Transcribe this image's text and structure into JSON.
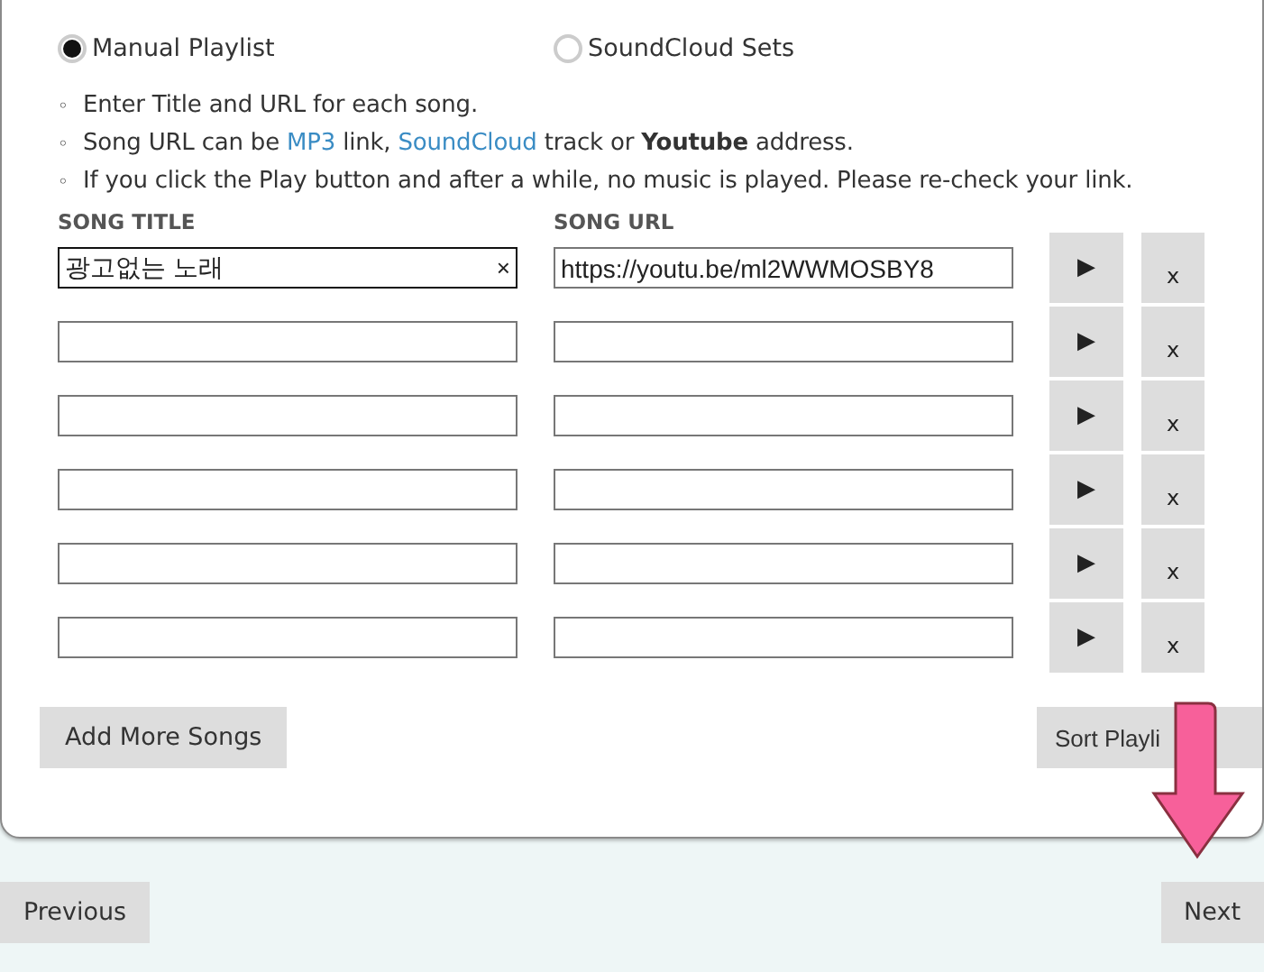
{
  "source_options": [
    {
      "label": "Manual Playlist",
      "selected": true
    },
    {
      "label": "SoundCloud Sets",
      "selected": false
    }
  ],
  "notes": [
    {
      "bullet": "◦",
      "segments": [
        {
          "kind": "plain",
          "text": "Enter Title and URL for each song."
        }
      ]
    },
    {
      "bullet": "◦",
      "segments": [
        {
          "kind": "plain",
          "text": "Song URL can be "
        },
        {
          "kind": "link",
          "text": "MP3"
        },
        {
          "kind": "plain",
          "text": " link, "
        },
        {
          "kind": "link",
          "text": "SoundCloud"
        },
        {
          "kind": "plain",
          "text": " track or "
        },
        {
          "kind": "bold",
          "text": "Youtube"
        },
        {
          "kind": "plain",
          "text": " address."
        }
      ]
    },
    {
      "bullet": "◦",
      "segments": [
        {
          "kind": "plain",
          "text": "If you click the Play button and after a while, no music is played. Please re-check your link."
        }
      ]
    }
  ],
  "columns": [
    "SONG TITLE",
    "SONG URL"
  ],
  "songs": [
    {
      "title": "광고없는 노래",
      "clear": "×",
      "url": "https://youtu.be/ml2WWMOSBY8",
      "play": "▶",
      "remove": "x",
      "focused": true
    },
    {
      "play": "▶",
      "remove": "x",
      "focused": false
    },
    {
      "play": "▶",
      "remove": "x",
      "focused": false
    },
    {
      "play": "▶",
      "remove": "x",
      "focused": false
    },
    {
      "play": "▶",
      "remove": "x",
      "focused": false
    },
    {
      "play": "▶",
      "remove": "x",
      "focused": false
    }
  ],
  "card_buttons": [
    "Add More Songs",
    "Sort Playli"
  ],
  "nav_buttons": [
    "Previous",
    "Next"
  ]
}
